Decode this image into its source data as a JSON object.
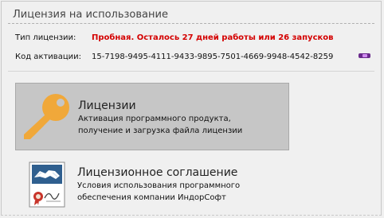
{
  "panel": {
    "title": "Лицензия на использование"
  },
  "license_info": {
    "type_label": "Тип лицензии:",
    "type_value": "Пробная. Осталось 27 дней работы или 26 запусков",
    "code_label": "Код активации:",
    "code_value": "15-7198-9495-4111-9433-9895-7501-4669-9948-4542-8259"
  },
  "tiles": {
    "licenses": {
      "icon": "key-icon",
      "title": "Лицензии",
      "desc_line1": "Активация программного продукта,",
      "desc_line2": "получение и загрузка файла лицензии"
    },
    "agreement": {
      "icon": "license-agreement-icon",
      "title": "Лицензионное соглашение",
      "desc_line1": "Условия использования программного",
      "desc_line2": "обеспечения компании ИндорСофт"
    }
  },
  "colors": {
    "trial_status": "#d40000",
    "key_icon": "#f0a83a",
    "selected_tile_bg": "#c6c6c6",
    "copy_handle": "#6a2a8c"
  }
}
